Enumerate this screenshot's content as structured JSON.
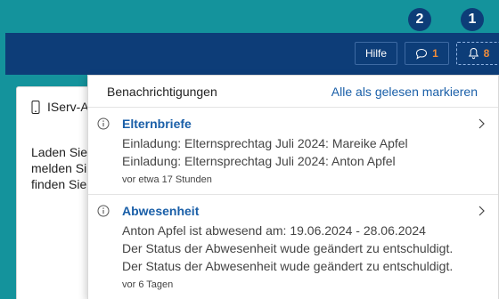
{
  "topbar": {
    "help_label": "Hilfe",
    "chat_count": "1",
    "bell_count": "8",
    "chat_icon": "chat-bubble-icon",
    "bell_icon": "bell-icon"
  },
  "markers": [
    "2",
    "1"
  ],
  "background_panel": {
    "title": "IServ-A",
    "text": "Laden Sie\nmelden Si\nfinden Sie"
  },
  "notifications": {
    "header_title": "Benachrichtigungen",
    "mark_all_read": "Alle als gelesen markieren",
    "items": [
      {
        "title": "Elternbriefe",
        "lines": [
          "Einladung: Elternsprechtag Juli 2024: Mareike Apfel",
          "Einladung: Elternsprechtag Juli 2024: Anton Apfel"
        ],
        "time": "vor etwa 17 Stunden"
      },
      {
        "title": "Abwesenheit",
        "lines": [
          "Anton Apfel ist abwesend am: 19.06.2024 - 28.06.2024",
          "Der Status der Abwesenheit wude geändert zu entschuldigt.",
          "Der Status der Abwesenheit wude geändert zu entschuldigt."
        ],
        "time": "vor 6 Tagen"
      }
    ]
  },
  "colors": {
    "page_background": "#14939c",
    "topbar": "#0d3d78",
    "badge_count": "#f08c3a",
    "link": "#1a5fa8"
  }
}
